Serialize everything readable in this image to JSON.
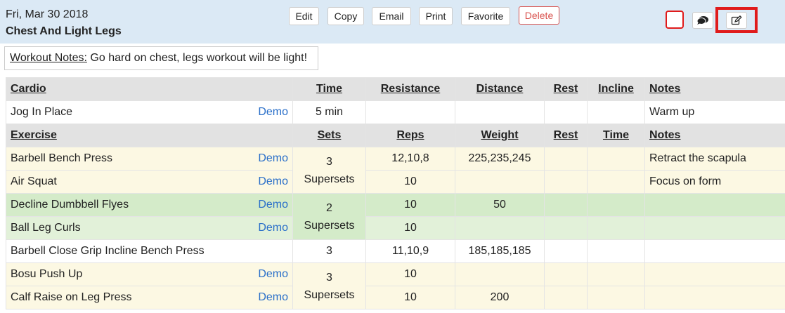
{
  "workout": {
    "date": "Fri, Mar 30 2018",
    "title": "Chest And Light Legs"
  },
  "actions": {
    "edit": "Edit",
    "copy": "Copy",
    "email": "Email",
    "print": "Print",
    "favorite": "Favorite",
    "delete": "Delete"
  },
  "icons": {
    "checkbox": "checkbox-icon",
    "comment": "comment-icon",
    "edit": "edit-icon"
  },
  "notes": {
    "label": "Workout Notes:",
    "text": " Go hard on chest, legs workout will be light!"
  },
  "cardio_headers": [
    "Cardio",
    "Time",
    "Resistance",
    "Distance",
    "Rest",
    "Incline",
    "Notes"
  ],
  "cardio_rows": [
    {
      "name": "Jog In Place",
      "demo": "Demo",
      "time": "5 min",
      "resistance": "",
      "distance": "",
      "rest": "",
      "incline": "",
      "notes": "Warm up"
    }
  ],
  "exercise_headers": [
    "Exercise",
    "Sets",
    "Reps",
    "Weight",
    "Rest",
    "Time",
    "Notes"
  ],
  "exercises": [
    {
      "name": "Barbell Bench Press",
      "demo": "Demo",
      "reps": "12,10,8",
      "weight": "225,235,245",
      "notes": "Retract the scapula"
    },
    {
      "name": "Air Squat",
      "demo": "Demo",
      "reps": "10",
      "weight": "",
      "notes": "Focus on form"
    },
    {
      "name": "Decline Dumbbell Flyes",
      "demo": "Demo",
      "reps": "10",
      "weight": "50",
      "notes": ""
    },
    {
      "name": "Ball Leg Curls",
      "demo": "Demo",
      "reps": "10",
      "weight": "",
      "notes": ""
    },
    {
      "name": "Barbell Close Grip Incline Bench Press",
      "demo": "",
      "sets": "3",
      "reps": "11,10,9",
      "weight": "185,185,185",
      "notes": ""
    },
    {
      "name": "Bosu Push Up",
      "demo": "Demo",
      "reps": "10",
      "weight": "",
      "notes": ""
    },
    {
      "name": "Calf Raise on Leg Press",
      "demo": "Demo",
      "reps": "10",
      "weight": "200",
      "notes": ""
    }
  ],
  "groups": [
    {
      "sets": "3",
      "label": "Supersets"
    },
    {
      "sets": "2",
      "label": "Supersets"
    },
    {
      "sets": "3",
      "label": "Supersets"
    }
  ],
  "colors": {
    "header_bg": "#dbe9f5",
    "superset_yellow": "#fcf8e3",
    "superset_green": "#d4ebc9",
    "link": "#2a6fc9",
    "delete": "#d9534f",
    "highlight": "#e01b1b"
  }
}
